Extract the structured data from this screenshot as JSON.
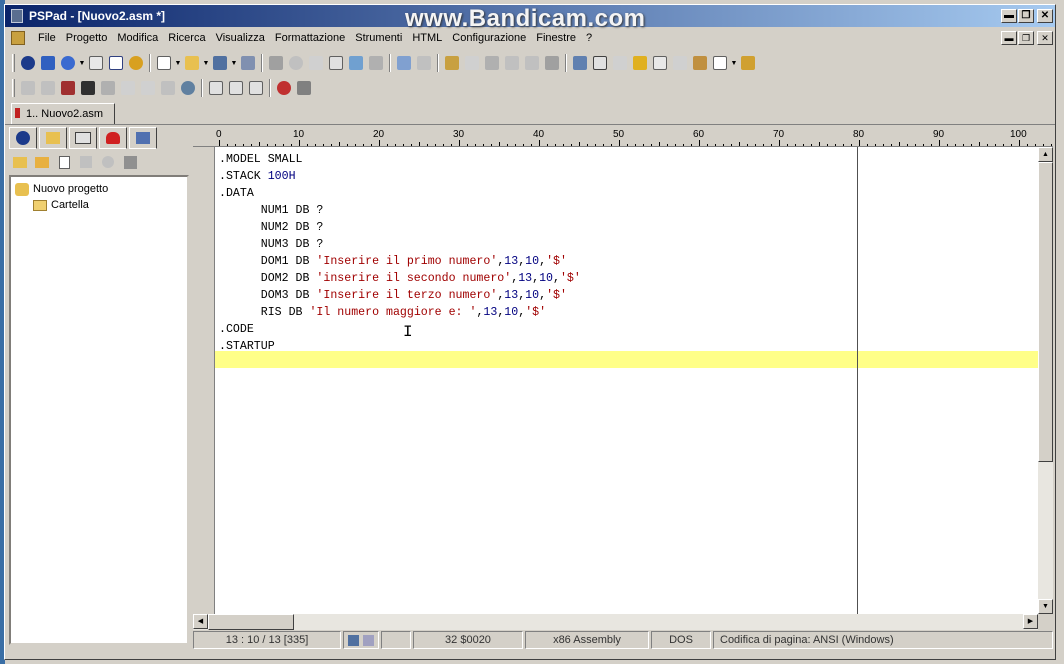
{
  "window": {
    "title": "PSPad - [Nuovo2.asm *]",
    "watermark": "www.Bandicam.com",
    "caption_minimize": "▬",
    "caption_restore": "❐",
    "caption_close": "✕"
  },
  "menu": {
    "items": [
      "File",
      "Progetto",
      "Modifica",
      "Ricerca",
      "Visualizza",
      "Formattazione",
      "Strumenti",
      "HTML",
      "Configurazione",
      "Finestre",
      "?"
    ]
  },
  "tabs": {
    "active_label": "1.. Nuovo2.asm"
  },
  "project_panel": {
    "root_label": "Nuovo progetto",
    "folder_label": "Cartella"
  },
  "ruler": {
    "labels": [
      "0",
      "10",
      "20",
      "30",
      "40",
      "50",
      "60",
      "70",
      "80",
      "90",
      "100"
    ]
  },
  "editor": {
    "lines": [
      ".MODEL SMALL",
      ".STACK 100H",
      ".DATA",
      "      NUM1 DB ?",
      "      NUM2 DB ?",
      "      NUM3 DB ?",
      "      DOM1 DB 'Inserire il primo numero',13,10,'$'",
      "      DOM2 DB 'inserire il secondo numero',13,10,'$'",
      "      DOM3 DB 'Inserire il terzo numero',13,10,'$'",
      "      RIS DB 'Il numero maggiore e: ',13,10,'$'",
      ".CODE",
      ".STARTUP",
      ""
    ],
    "current_line_color": "#ffff88"
  },
  "statusbar": {
    "position": "13 : 10 / 13  [335]",
    "char_code": "32  $0020",
    "syntax": "x86 Assembly",
    "line_endings": "DOS",
    "encoding": "Codifica di pagina: ANSI (Windows)"
  },
  "colors": {
    "title_start": "#0a246a",
    "title_end": "#a6caf0",
    "face": "#d4d0c8"
  }
}
